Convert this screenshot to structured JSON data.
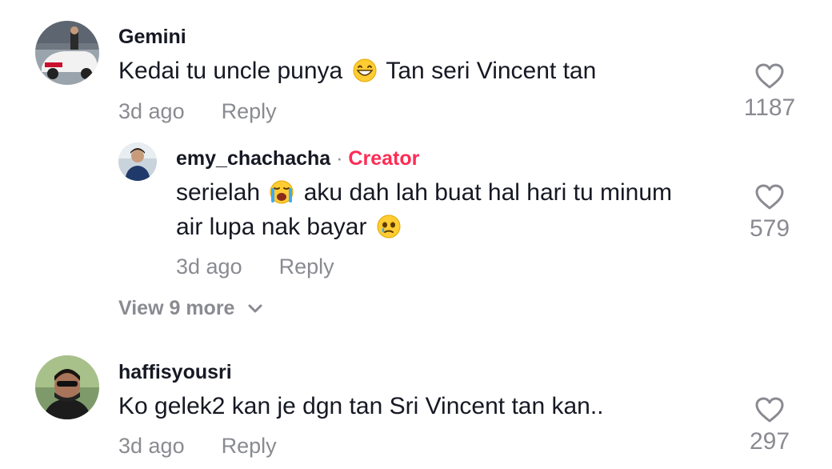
{
  "comments": [
    {
      "username": "Gemini",
      "text_before_emoji": "Kedai tu uncle punya",
      "emoji": "grinning-face-emoji",
      "text_after_emoji": "Tan seri Vincent tan",
      "time": "3d ago",
      "reply_label": "Reply",
      "likes": "1187",
      "replies": [
        {
          "username": "emy_chachacha",
          "separator": "·",
          "badge": "Creator",
          "line1_before_emoji": "serielah",
          "line1_emoji": "loudly-crying-face-emoji",
          "line1_after_emoji": "aku dah lah buat hal hari tu minum",
          "line2_before_emoji": "air lupa nak bayar",
          "line2_emoji": "face-holding-back-tears-emoji",
          "time": "3d ago",
          "reply_label": "Reply",
          "likes": "579"
        }
      ],
      "view_more_label": "View 9 more"
    },
    {
      "username": "haffisyousri",
      "text": "Ko gelek2 kan je dgn tan Sri Vincent tan kan..",
      "time": "3d ago",
      "reply_label": "Reply",
      "likes": "297"
    }
  ],
  "colors": {
    "text": "#161823",
    "muted": "#8a8b91",
    "creator_badge": "#fe2c55"
  }
}
